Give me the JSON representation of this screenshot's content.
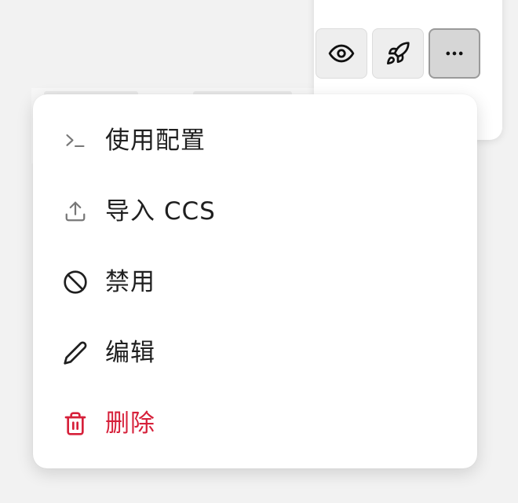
{
  "toolbar": {
    "buttons": [
      {
        "id": "preview",
        "icon": "eye-icon",
        "active": false
      },
      {
        "id": "launch",
        "icon": "rocket-icon",
        "active": false
      },
      {
        "id": "more",
        "icon": "more-horizontal-icon",
        "active": true
      }
    ]
  },
  "menu": {
    "items": [
      {
        "label": "使用配置",
        "icon": "terminal-icon"
      },
      {
        "label": "导入 CCS",
        "icon": "upload-icon"
      },
      {
        "label": "禁用",
        "icon": "ban-icon"
      },
      {
        "label": "编辑",
        "icon": "pencil-icon"
      },
      {
        "label": "删除",
        "icon": "trash-icon"
      }
    ]
  },
  "colors": {
    "danger": "#d6203a",
    "text": "#1f1f1f",
    "active_button": "#d6d6d6"
  }
}
